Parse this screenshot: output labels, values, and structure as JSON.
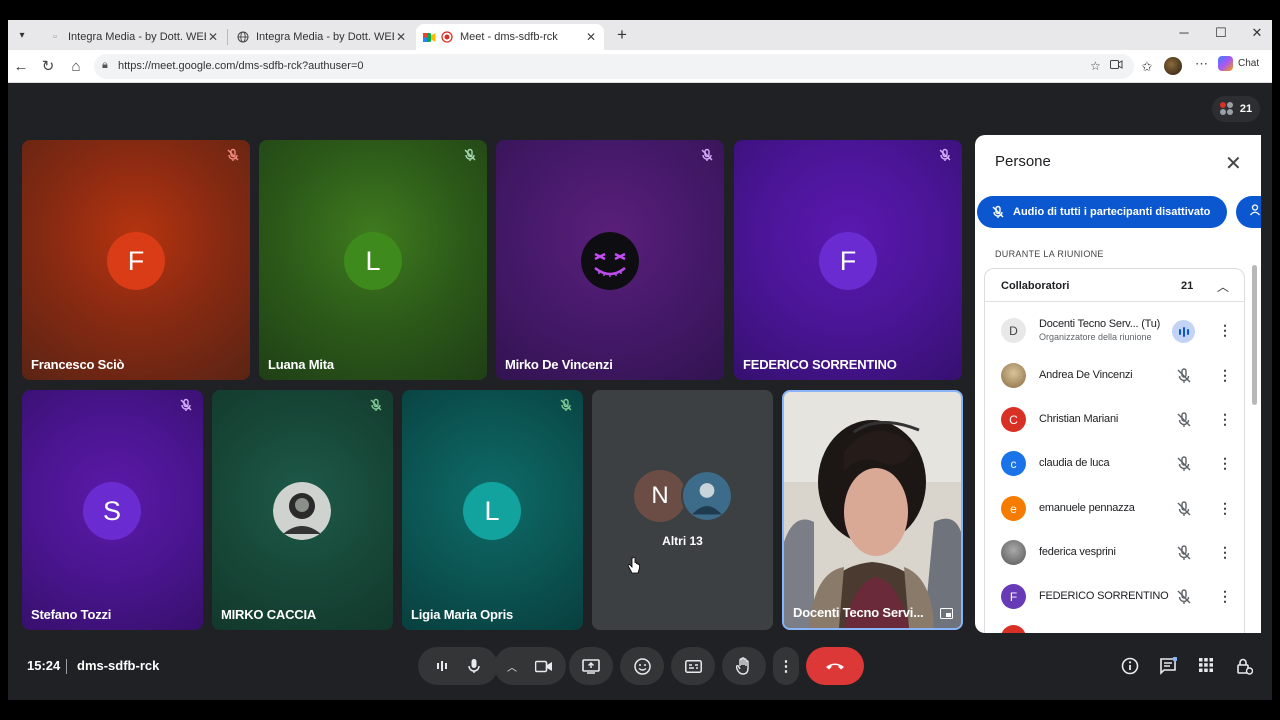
{
  "browser": {
    "tabs": [
      {
        "title": "Integra Media - by Dott. WEB Mas",
        "active": false
      },
      {
        "title": "Integra Media - by Dott. WEB Mas",
        "active": false
      },
      {
        "title": "Meet - dms-sdfb-rck",
        "active": true
      }
    ],
    "url": "https://meet.google.com/dms-sdfb-rck?authuser=0",
    "chat_label": "Chat"
  },
  "meet": {
    "participant_count": "21",
    "time": "15:24",
    "meeting_code": "dms-sdfb-rck",
    "tiles": [
      {
        "name": "Francesco Sciò",
        "initial": "F"
      },
      {
        "name": "Luana Mita",
        "initial": "L"
      },
      {
        "name": "Mirko De Vincenzi",
        "initial": ""
      },
      {
        "name": "FEDERICO SORRENTINO",
        "initial": "F"
      },
      {
        "name": "Stefano Tozzi",
        "initial": "S"
      },
      {
        "name": "MIRKO CACCIA",
        "initial": ""
      },
      {
        "name": "Ligia Maria Opris",
        "initial": "L"
      },
      {
        "name": "Altri 13",
        "initial": "N"
      },
      {
        "name": "Docenti Tecno Servi...",
        "initial": ""
      }
    ]
  },
  "panel": {
    "title": "Persone",
    "mute_all": "Audio di tutti i partecipanti disattivato",
    "section": "DURANTE LA RIUNIONE",
    "group": "Collaboratori",
    "group_count": "21",
    "people": [
      {
        "name": "Docenti Tecno Serv... (Tu)",
        "role": "Organizzatore della riunione",
        "initial": "D",
        "color": "#e8e8e8"
      },
      {
        "name": "Andrea De Vincenzi",
        "initial": "",
        "color": "#b89a6a"
      },
      {
        "name": "Christian Mariani",
        "initial": "C",
        "color": "#d93025"
      },
      {
        "name": "claudia de luca",
        "initial": "c",
        "color": "#1a73e8"
      },
      {
        "name": "emanuele pennazza",
        "initial": "e",
        "color": "#f57c00"
      },
      {
        "name": "federica vesprini",
        "initial": "",
        "color": "#6b6b6b"
      },
      {
        "name": "FEDERICO SORRENTINO",
        "initial": "F",
        "color": "#673ab7"
      }
    ]
  },
  "colors": {
    "meet_bg": "#202124",
    "accent_blue": "#0b57d0",
    "end_call_red": "#dc3838"
  }
}
